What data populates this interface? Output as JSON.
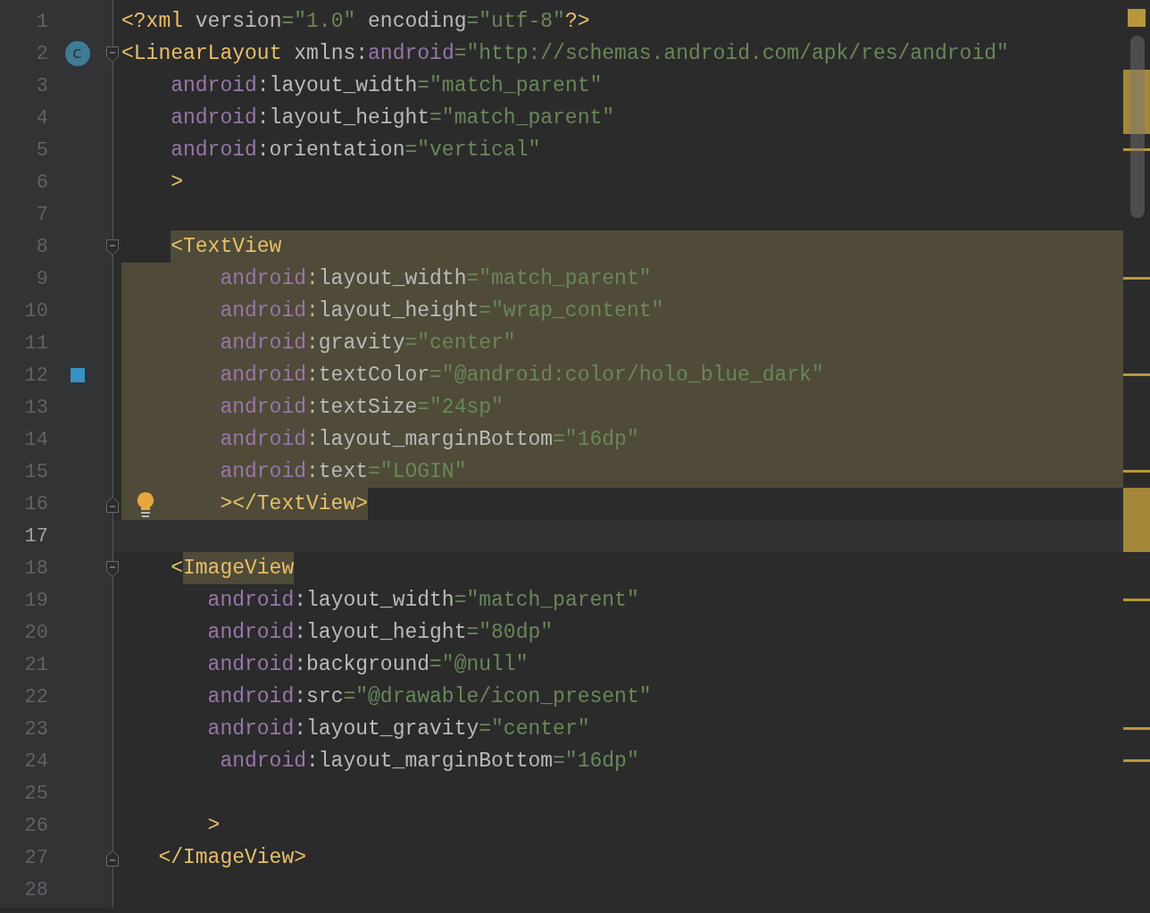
{
  "lines": [
    {
      "number": "1",
      "stripe": {
        "kind": "status"
      },
      "tokens": [
        {
          "kind": "tag",
          "text": "<?xml"
        },
        {
          "kind": "plain",
          "text": " version"
        },
        {
          "kind": "value",
          "text": "=\"1.0\""
        },
        {
          "kind": "plain",
          "text": " encoding"
        },
        {
          "kind": "value",
          "text": "=\"utf-8\""
        },
        {
          "kind": "tag",
          "text": "?>"
        }
      ]
    },
    {
      "number": "2",
      "fold": {
        "kind": "start"
      },
      "gutter": {
        "kind": "class",
        "text": "C"
      },
      "tokens": [
        {
          "kind": "tag",
          "text": "<LinearLayout"
        },
        {
          "kind": "plain",
          "text": " xmlns:"
        },
        {
          "kind": "ns",
          "text": "android"
        },
        {
          "kind": "value",
          "text": "=\"http://schemas.android.com/apk/res/android\""
        }
      ]
    },
    {
      "number": "3",
      "stripe": {
        "kind": "block"
      },
      "indent": {
        "kind": "four"
      },
      "tokens": [
        {
          "kind": "ns",
          "text": "android"
        },
        {
          "kind": "plain",
          "text": ":layout_width"
        },
        {
          "kind": "value",
          "text": "=\"match_parent\""
        }
      ]
    },
    {
      "number": "4",
      "stripe": {
        "kind": "block"
      },
      "indent": {
        "kind": "four"
      },
      "tokens": [
        {
          "kind": "ns",
          "text": "android"
        },
        {
          "kind": "plain",
          "text": ":layout_height"
        },
        {
          "kind": "value",
          "text": "=\"match_parent\""
        }
      ]
    },
    {
      "number": "5",
      "stripe": {
        "kind": "dash"
      },
      "indent": {
        "kind": "four"
      },
      "tokens": [
        {
          "kind": "ns",
          "text": "android"
        },
        {
          "kind": "plain",
          "text": ":orientation"
        },
        {
          "kind": "value",
          "text": "=\"vertical\""
        }
      ]
    },
    {
      "number": "6",
      "indent": {
        "kind": "four"
      },
      "tokens": [
        {
          "kind": "tag",
          "text": ">"
        }
      ]
    },
    {
      "number": "7"
    },
    {
      "number": "8",
      "fold": {
        "kind": "start"
      },
      "highlight": {
        "kind": "from_text"
      },
      "indent": {
        "kind": "four"
      },
      "tokens": [
        {
          "kind": "tag",
          "text": "<TextView"
        }
      ]
    },
    {
      "number": "9",
      "stripe": {
        "kind": "dash"
      },
      "highlight": {
        "kind": "full"
      },
      "indent": {
        "kind": "eight"
      },
      "tokens": [
        {
          "kind": "ns",
          "text": "android"
        },
        {
          "kind": "plain",
          "text": ":layout_width"
        },
        {
          "kind": "value",
          "text": "=\"match_parent\""
        }
      ]
    },
    {
      "number": "10",
      "highlight": {
        "kind": "full"
      },
      "indent": {
        "kind": "eight"
      },
      "tokens": [
        {
          "kind": "ns",
          "text": "android"
        },
        {
          "kind": "plain",
          "text": ":layout_height"
        },
        {
          "kind": "value",
          "text": "=\"wrap_content\""
        }
      ]
    },
    {
      "number": "11",
      "highlight": {
        "kind": "full"
      },
      "indent": {
        "kind": "eight"
      },
      "tokens": [
        {
          "kind": "ns",
          "text": "android"
        },
        {
          "kind": "plain",
          "text": ":gravity"
        },
        {
          "kind": "value",
          "text": "=\"center\""
        }
      ]
    },
    {
      "number": "12",
      "stripe": {
        "kind": "dash"
      },
      "highlight": {
        "kind": "full"
      },
      "indent": {
        "kind": "eight"
      },
      "gutter": {
        "kind": "swatch",
        "color": "#3592c4"
      },
      "tokens": [
        {
          "kind": "ns",
          "text": "android"
        },
        {
          "kind": "plain",
          "text": ":textColor"
        },
        {
          "kind": "value",
          "text": "=\"@android:color/holo_blue_dark\""
        }
      ]
    },
    {
      "number": "13",
      "highlight": {
        "kind": "full"
      },
      "indent": {
        "kind": "eight"
      },
      "tokens": [
        {
          "kind": "ns",
          "text": "android"
        },
        {
          "kind": "plain",
          "text": ":textSize"
        },
        {
          "kind": "value",
          "text": "=\"24sp\""
        }
      ]
    },
    {
      "number": "14",
      "highlight": {
        "kind": "full"
      },
      "indent": {
        "kind": "eight"
      },
      "tokens": [
        {
          "kind": "ns",
          "text": "android"
        },
        {
          "kind": "plain",
          "text": ":layout_marginBottom"
        },
        {
          "kind": "value",
          "text": "=\"16dp\""
        }
      ]
    },
    {
      "number": "15",
      "stripe": {
        "kind": "dash"
      },
      "highlight": {
        "kind": "full"
      },
      "indent": {
        "kind": "eight"
      },
      "tokens": [
        {
          "kind": "ns",
          "text": "android"
        },
        {
          "kind": "plain",
          "text": ":text"
        },
        {
          "kind": "value",
          "text": "=\"LOGIN\""
        }
      ]
    },
    {
      "number": "16",
      "stripe": {
        "kind": "block"
      },
      "fold": {
        "kind": "end"
      },
      "highlight": {
        "kind": "to_text_end"
      },
      "indent": {
        "kind": "eight"
      },
      "gutter": {
        "kind": "bulb"
      },
      "tokens": [
        {
          "kind": "tag",
          "text": "></TextView>"
        }
      ]
    },
    {
      "number": "17",
      "stripe": {
        "kind": "block"
      },
      "current": true
    },
    {
      "number": "18",
      "fold": {
        "kind": "start"
      },
      "indent": {
        "kind": "four"
      },
      "tokens": [
        {
          "kind": "tag",
          "text": "<"
        },
        {
          "kind": "tag",
          "text": "ImageView",
          "highlighted": true
        }
      ]
    },
    {
      "number": "19",
      "stripe": {
        "kind": "dash"
      },
      "indent": {
        "kind": "seven"
      },
      "tokens": [
        {
          "kind": "ns",
          "text": "android"
        },
        {
          "kind": "plain",
          "text": ":layout_width"
        },
        {
          "kind": "value",
          "text": "=\"match_parent\""
        }
      ]
    },
    {
      "number": "20",
      "indent": {
        "kind": "seven"
      },
      "tokens": [
        {
          "kind": "ns",
          "text": "android"
        },
        {
          "kind": "plain",
          "text": ":layout_height"
        },
        {
          "kind": "value",
          "text": "=\"80dp\""
        }
      ]
    },
    {
      "number": "21",
      "indent": {
        "kind": "seven"
      },
      "tokens": [
        {
          "kind": "ns",
          "text": "android"
        },
        {
          "kind": "plain",
          "text": ":background"
        },
        {
          "kind": "value",
          "text": "=\"@null\""
        }
      ]
    },
    {
      "number": "22",
      "indent": {
        "kind": "seven"
      },
      "tokens": [
        {
          "kind": "ns",
          "text": "android"
        },
        {
          "kind": "plain",
          "text": ":src"
        },
        {
          "kind": "value",
          "text": "=\"@drawable/icon_present\""
        }
      ]
    },
    {
      "number": "23",
      "stripe": {
        "kind": "dash"
      },
      "indent": {
        "kind": "seven"
      },
      "tokens": [
        {
          "kind": "ns",
          "text": "android"
        },
        {
          "kind": "plain",
          "text": ":layout_gravity"
        },
        {
          "kind": "value",
          "text": "=\"center\""
        }
      ]
    },
    {
      "number": "24",
      "stripe": {
        "kind": "dash"
      },
      "indent": {
        "kind": "eight"
      },
      "tokens": [
        {
          "kind": "ns",
          "text": "android"
        },
        {
          "kind": "plain",
          "text": ":layout_marginBottom"
        },
        {
          "kind": "value",
          "text": "=\"16dp\""
        }
      ]
    },
    {
      "number": "25"
    },
    {
      "number": "26",
      "indent": {
        "kind": "seven"
      },
      "tokens": [
        {
          "kind": "tag",
          "text": ">"
        }
      ]
    },
    {
      "number": "27",
      "fold": {
        "kind": "end"
      },
      "indent": {
        "kind": "three"
      },
      "tokens": [
        {
          "kind": "tag",
          "text": "</ImageView>"
        }
      ]
    },
    {
      "number": "28"
    }
  ]
}
